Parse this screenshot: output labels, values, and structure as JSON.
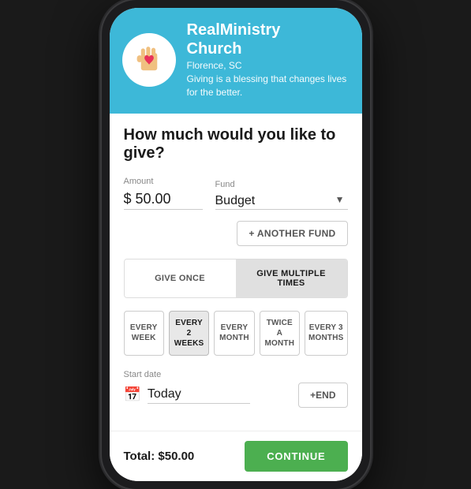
{
  "header": {
    "org_name_line1": "RealMinistry",
    "org_name_line2": "Church",
    "location": "Florence, SC",
    "tagline": "Giving is a blessing that changes lives for the better."
  },
  "main": {
    "question": "How much would you like to give?",
    "amount_label": "Amount",
    "amount_value": "$ 50.00",
    "fund_label": "Fund",
    "fund_value": "Budget",
    "another_fund_btn": "+ ANOTHER FUND",
    "give_once_label": "GIVE ONCE",
    "give_multiple_label": "GIVE MULTIPLE TIMES",
    "frequencies": [
      {
        "id": "every-week",
        "label": "EVERY\nWEEK",
        "active": false
      },
      {
        "id": "every-2-weeks",
        "label": "EVERY 2\nWEEKS",
        "active": true
      },
      {
        "id": "every-month",
        "label": "EVERY\nMONTH",
        "active": false
      },
      {
        "id": "twice-a-month",
        "label": "TWICE A\nMONTH",
        "active": false
      },
      {
        "id": "every-3-months",
        "label": "EVERY 3\nMONTHS",
        "active": false
      }
    ],
    "start_date_label": "Start date",
    "start_date_value": "Today",
    "end_btn": "+END"
  },
  "footer": {
    "total_label": "Total: $50.00",
    "continue_btn": "CONTINUE"
  }
}
